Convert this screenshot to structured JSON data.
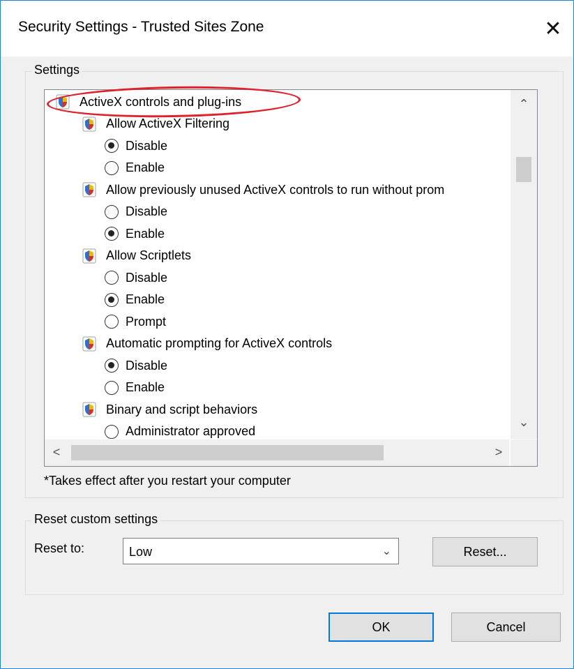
{
  "window": {
    "title": "Security Settings - Trusted Sites Zone",
    "close_glyph": "✕"
  },
  "settings_group": {
    "label": "Settings"
  },
  "settings_list": [
    {
      "kind": "category",
      "label": "ActiveX controls and plug-ins"
    },
    {
      "kind": "setting",
      "label": "Allow ActiveX Filtering"
    },
    {
      "kind": "option",
      "label": "Disable",
      "selected": true
    },
    {
      "kind": "option",
      "label": "Enable",
      "selected": false
    },
    {
      "kind": "setting",
      "label": "Allow previously unused ActiveX controls to run without prom"
    },
    {
      "kind": "option",
      "label": "Disable",
      "selected": false
    },
    {
      "kind": "option",
      "label": "Enable",
      "selected": true
    },
    {
      "kind": "setting",
      "label": "Allow Scriptlets"
    },
    {
      "kind": "option",
      "label": "Disable",
      "selected": false
    },
    {
      "kind": "option",
      "label": "Enable",
      "selected": true
    },
    {
      "kind": "option",
      "label": "Prompt",
      "selected": false
    },
    {
      "kind": "setting",
      "label": "Automatic prompting for ActiveX controls"
    },
    {
      "kind": "option",
      "label": "Disable",
      "selected": true
    },
    {
      "kind": "option",
      "label": "Enable",
      "selected": false
    },
    {
      "kind": "setting",
      "label": "Binary and script behaviors"
    },
    {
      "kind": "option",
      "label": "Administrator approved",
      "selected": false
    }
  ],
  "scrollbar": {
    "up": "⌃",
    "down": "⌄",
    "left": "<",
    "right": ">"
  },
  "note": "*Takes effect after you restart your computer",
  "reset_group": {
    "label": "Reset custom settings",
    "reset_to_label": "Reset to:",
    "selected_level": "Low",
    "reset_button": "Reset..."
  },
  "footer": {
    "ok": "OK",
    "cancel": "Cancel"
  },
  "colors": {
    "accent": "#0078d7",
    "highlight_ellipse": "#e0202a",
    "window_border": "#1883d7"
  }
}
